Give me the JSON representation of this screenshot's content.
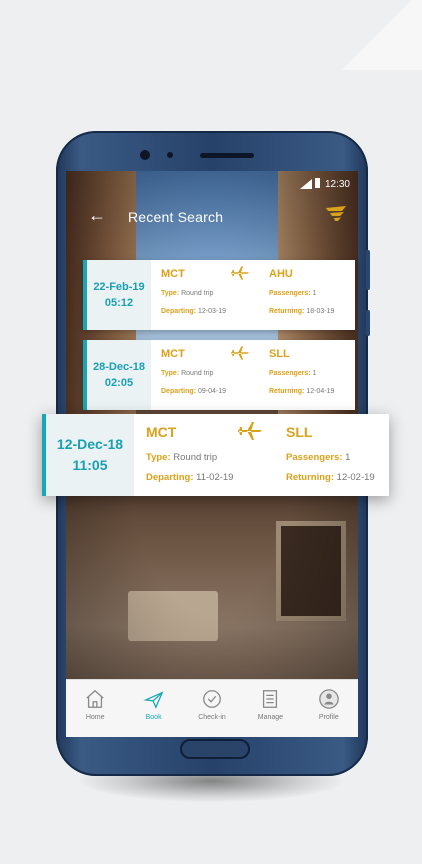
{
  "status": {
    "time": "12:30"
  },
  "header": {
    "title": "Recent Search"
  },
  "searches": [
    {
      "date": "22-Feb-19",
      "time": "05:12",
      "from": "MCT",
      "to": "AHU",
      "type_label": "Type:",
      "type": "Round trip",
      "departing_label": "Departing:",
      "departing": "12-03-19",
      "passengers_label": "Passengers:",
      "passengers": "1",
      "returning_label": "Returning:",
      "returning": "18-03-19"
    },
    {
      "date": "28-Dec-18",
      "time": "02:05",
      "from": "MCT",
      "to": "SLL",
      "type_label": "Type:",
      "type": "Round trip",
      "departing_label": "Departing:",
      "departing": "09-04-19",
      "passengers_label": "Passengers:",
      "passengers": "1",
      "returning_label": "Returning:",
      "returning": "12-04-19"
    },
    {
      "date": "12-Dec-18",
      "time": "11:05",
      "from": "MCT",
      "to": "SLL",
      "type_label": "Type:",
      "type": "Round trip",
      "departing_label": "Departing:",
      "departing": "11-02-19",
      "passengers_label": "Passengers:",
      "passengers": "1",
      "returning_label": "Returning:",
      "returning": "12-02-19"
    }
  ],
  "tabs": [
    {
      "label": "Home",
      "icon": "home-icon"
    },
    {
      "label": "Book",
      "icon": "plane-icon",
      "active": true
    },
    {
      "label": "Check-in",
      "icon": "check-circle-icon"
    },
    {
      "label": "Manage",
      "icon": "document-icon"
    },
    {
      "label": "Profile",
      "icon": "user-icon"
    }
  ],
  "colors": {
    "accent": "#19a7b8",
    "gold": "#d9a21b",
    "phone": "#26426a"
  }
}
